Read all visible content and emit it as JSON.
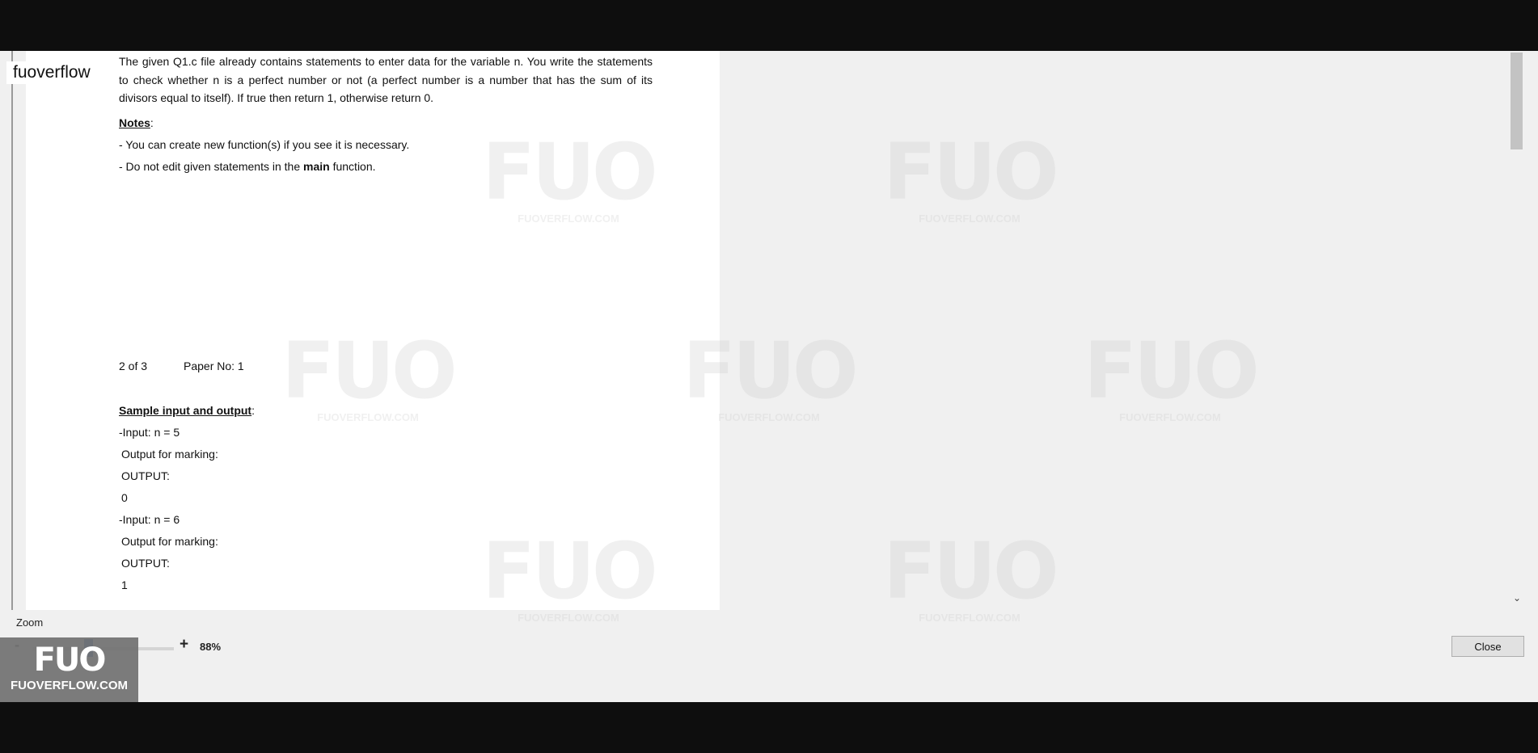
{
  "overlay_label": "fuoverflow",
  "document": {
    "paragraph": "The given Q1.c file already contains statements to enter data for the variable n. You write the statements to check whether n is a perfect number or not (a perfect number is a number that has the sum of its divisors equal to itself). If true then return 1, otherwise return 0.",
    "notes_heading": "Notes",
    "colon": ":",
    "note1": "- You can create new function(s) if you see it is necessary.",
    "note2_prefix": "- Do not edit given statements in the ",
    "note2_bold": "main",
    "note2_suffix": " function.",
    "page_indicator": "2 of 3",
    "paper_no": "Paper No: 1",
    "sample_heading": "Sample input and output",
    "sample_lines": [
      "-Input: n = 5",
      " Output for marking:",
      " OUTPUT:",
      " 0",
      "-Input: n = 6",
      " Output for marking:",
      " OUTPUT:",
      " 1"
    ]
  },
  "watermark": {
    "big": "FUO",
    "small": "FUOVERFLOW.COM"
  },
  "zoom": {
    "label": "Zoom",
    "minus": "-",
    "plus": "+",
    "value": "88%",
    "level_percent": 88
  },
  "close_button": "Close",
  "logo": {
    "big": "FUO",
    "small": "FUOVERFLOW.COM"
  }
}
